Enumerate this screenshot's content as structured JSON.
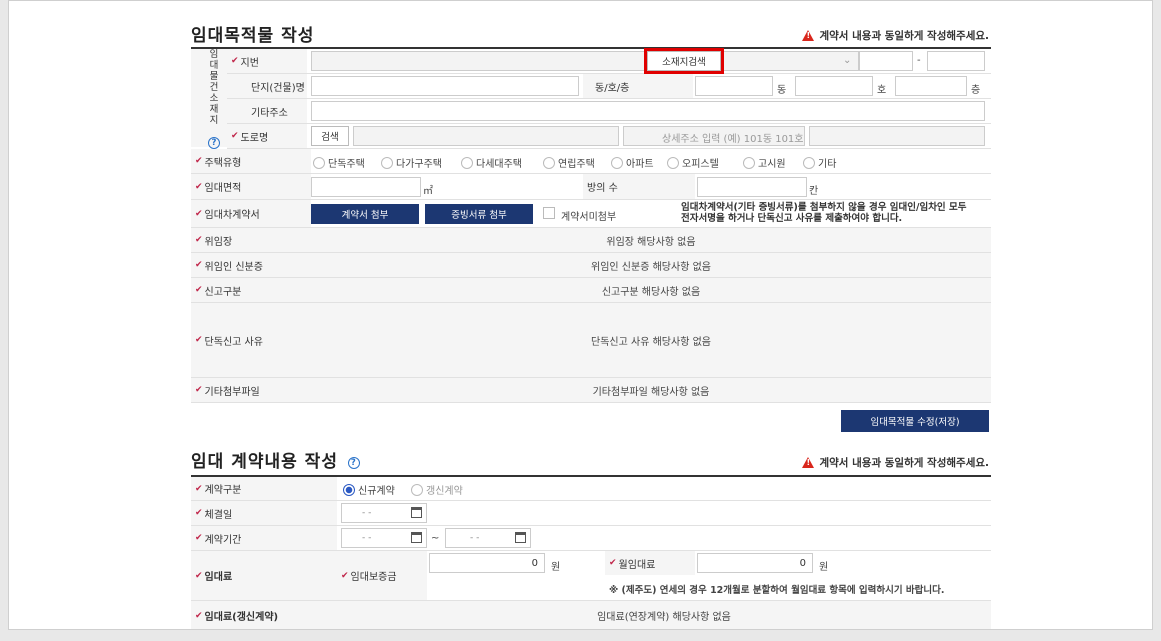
{
  "section1": {
    "title": "임대목적물 작성",
    "warning": "계약서 내용과 동일하게 작성해주세요.",
    "side_label": "임대물건소재지",
    "jibun_label": "지번",
    "search_loc_btn": "소재지검색",
    "jibun_dash": "-",
    "danji_label": "단지(건물)명",
    "dongho_label": "동/호/층",
    "dong_unit": "동",
    "ho_unit": "호",
    "floor_unit": "층",
    "etc_addr_label": "기타주소",
    "road_label": "도로명",
    "road_search_btn": "검색",
    "detail_addr_placeholder": "상세주소 입력 (예) 101동 101호",
    "house_type_label": "주택유형",
    "house_types": [
      "단독주택",
      "다가구주택",
      "다세대주택",
      "연립주택",
      "아파트",
      "오피스텔",
      "고시원",
      "기타"
    ],
    "area_label": "임대면적",
    "area_unit": "㎡",
    "rooms_label": "방의 수",
    "rooms_unit": "칸",
    "contract_label": "임대차계약서",
    "attach_contract_btn": "계약서 첨부",
    "attach_proof_btn": "증빙서류 첨부",
    "no_contract_label": "계약서미첨부",
    "contract_notice": "임대차계약서(기타 증빙서류)를 첨부하지 않을 경우 임대인/임차인 모두 전자서명을 하거나 단독신고 사유를 제출하여야 합니다.",
    "poa_label": "위임장",
    "poa_value": "위임장 해당사항 없음",
    "idcard_label": "위임인 신분증",
    "idcard_value": "위임인 신분증 해당사항 없음",
    "report_type_label": "신고구분",
    "report_type_value": "신고구분 해당사항 없음",
    "solo_reason_label": "단독신고 사유",
    "solo_reason_value": "단독신고 사유 해당사항 없음",
    "other_files_label": "기타첨부파일",
    "other_files_value": "기타첨부파일 해당사항 없음",
    "save_btn": "임대목적물 수정(저장)"
  },
  "section2": {
    "title": "임대 계약내용 작성",
    "warning": "계약서 내용과 동일하게 작성해주세요.",
    "contract_type_label": "계약구분",
    "contract_types": [
      "신규계약",
      "갱신계약"
    ],
    "selected_contract_type": "신규계약",
    "sign_date_label": "체결일",
    "date_placeholder": "- -",
    "period_label": "계약기간",
    "tilde": "~",
    "rent_label": "임대료",
    "deposit_label": "임대보증금",
    "deposit_value": "0",
    "won": "원",
    "monthly_label": "월임대료",
    "monthly_value": "0",
    "rent_note": "※ (제주도) 연세의 경우 12개월로 분할하여 월임대료 항목에 입력하시기 바랍니다.",
    "renew_rent_label": "임대료(갱신계약)",
    "renew_rent_value": "임대료(연장계약) 해당사항 없음"
  },
  "colors": {
    "navy": "#1c3772",
    "check": "#c0264a",
    "warn": "#d9261c",
    "highlight": "#e00000"
  }
}
